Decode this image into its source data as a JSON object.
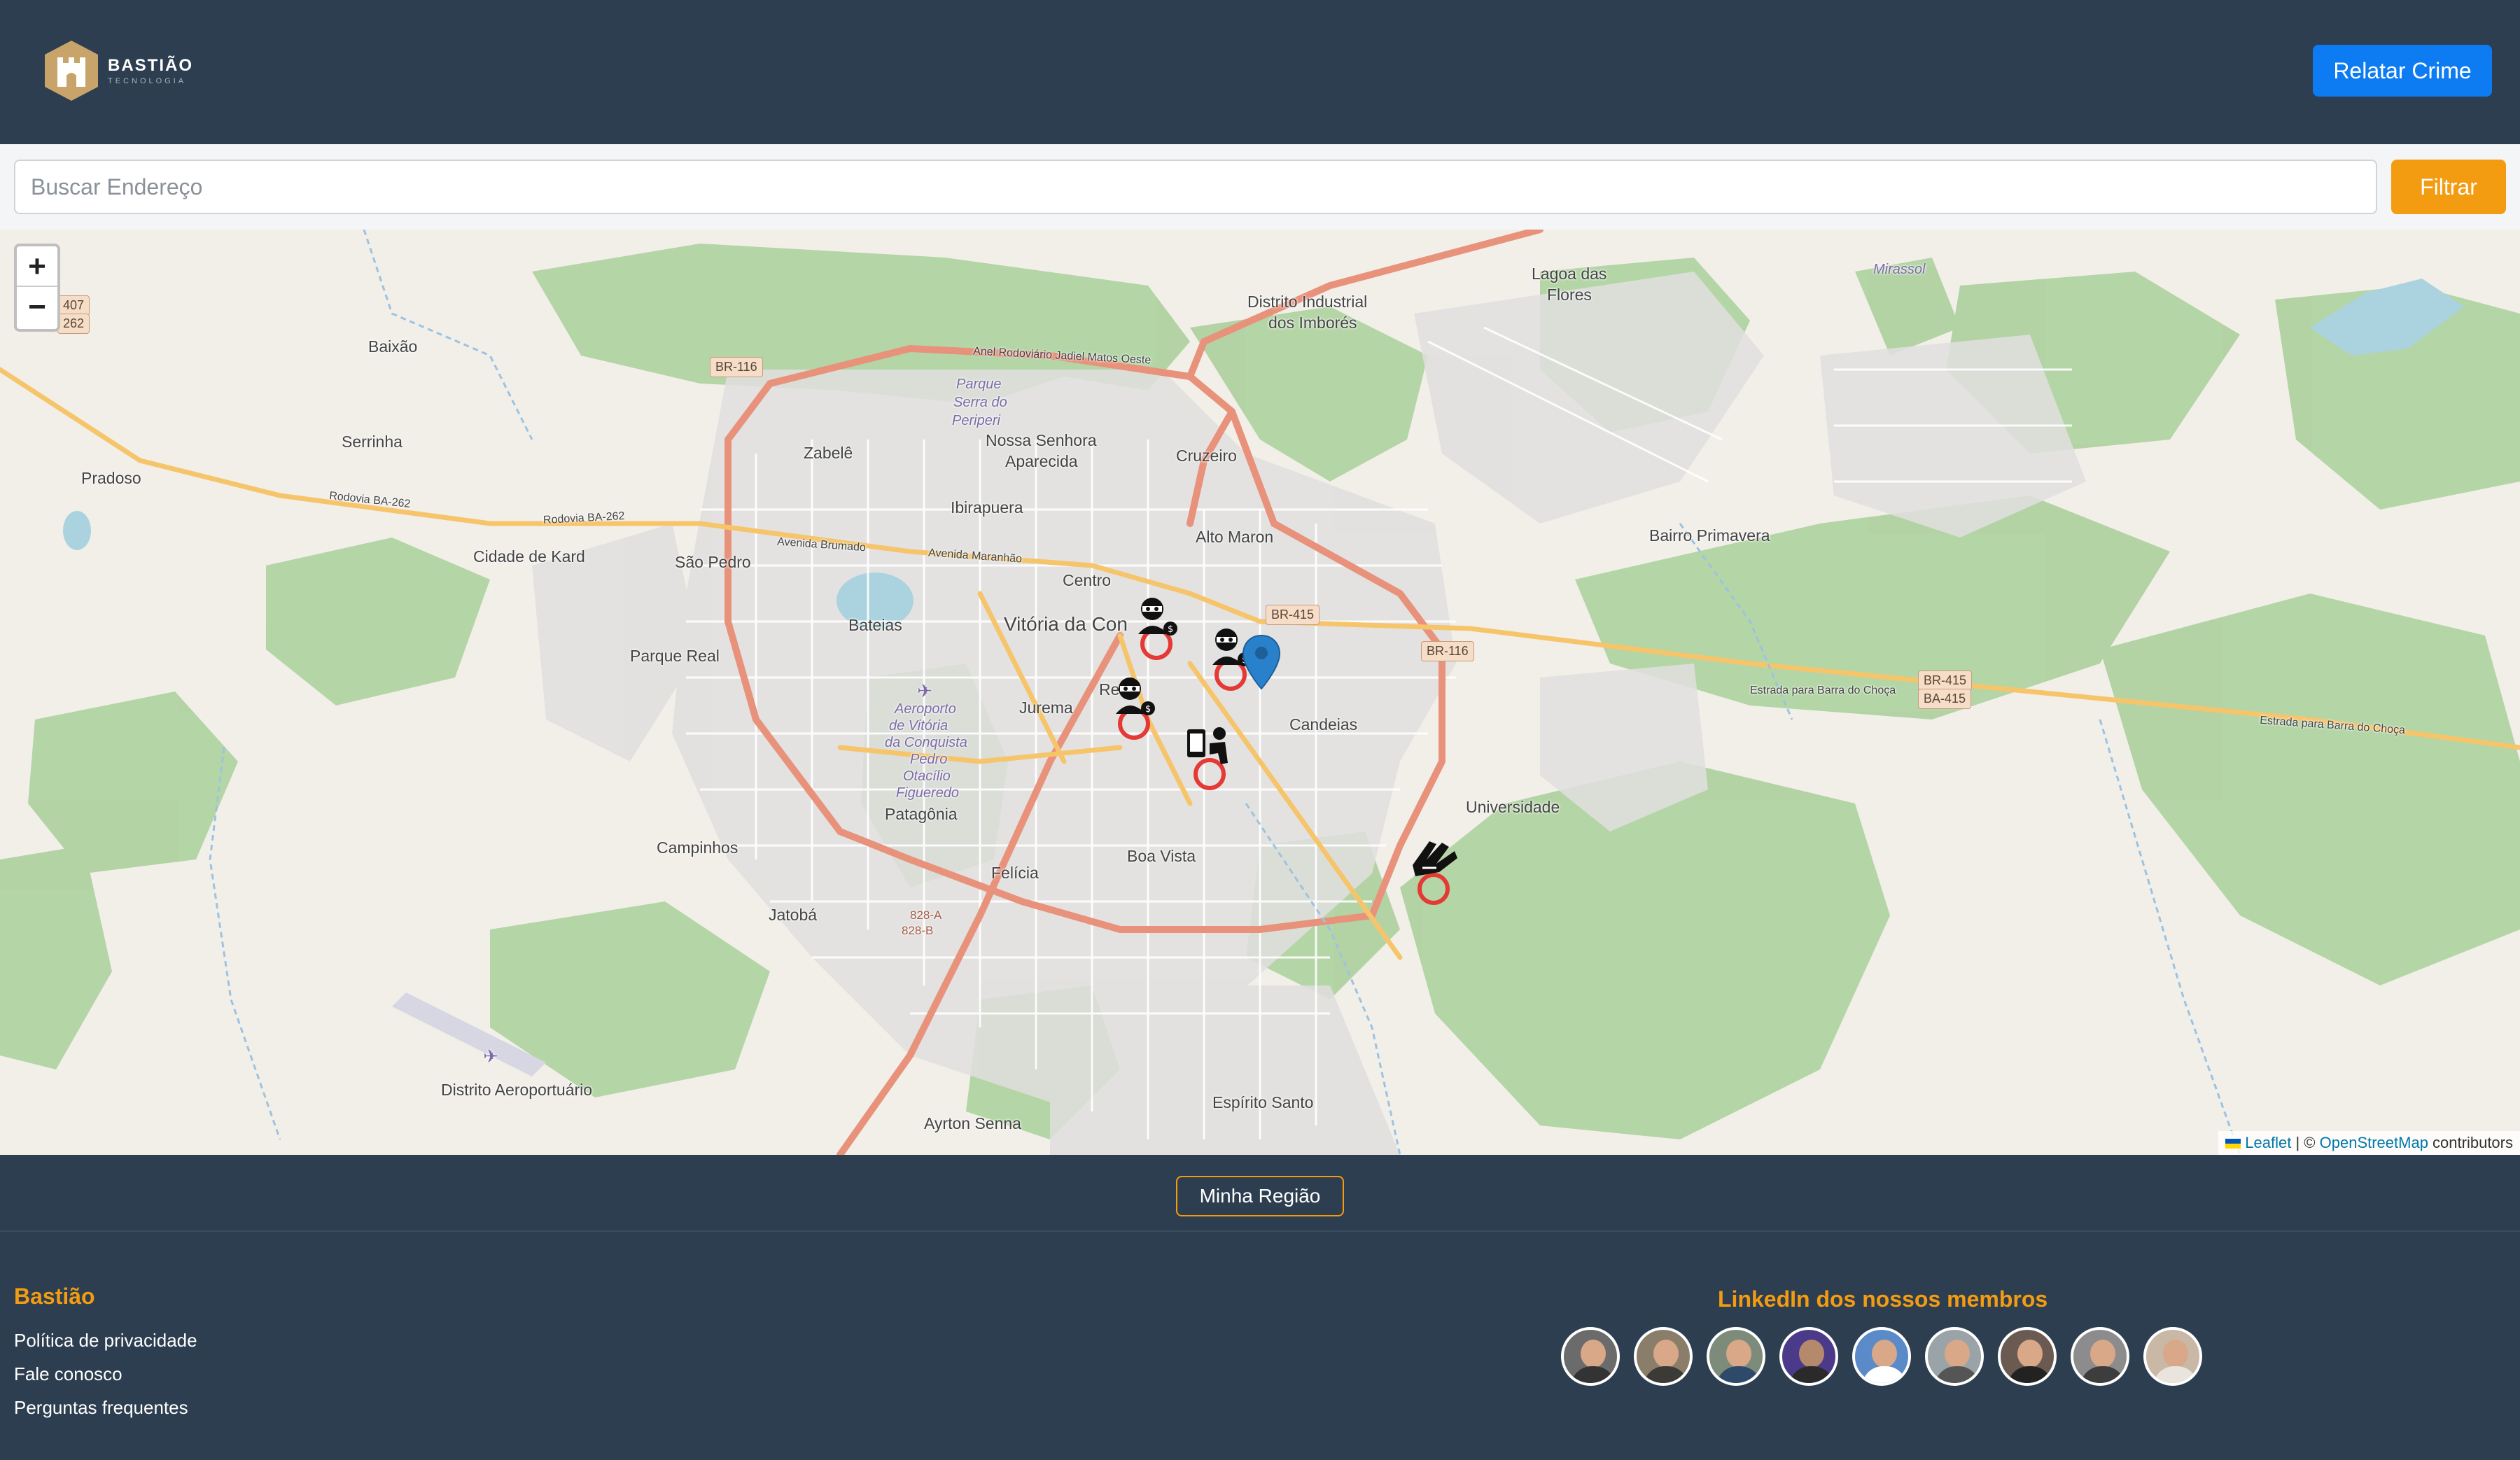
{
  "header": {
    "logo_name": "BASTIÃO",
    "logo_sub": "TECNOLOGIA",
    "report_button": "Relatar Crime"
  },
  "search": {
    "placeholder": "Buscar Endereço",
    "value": "",
    "filter_button": "Filtrar"
  },
  "map": {
    "zoom_in": "+",
    "zoom_out": "−",
    "places": {
      "distrito_industrial": "Distrito Industrial",
      "dos_imbores": "dos Imborés",
      "lagoa_das": "Lagoa das",
      "flores": "Flores",
      "mirassol": "Mirassol",
      "baixao": "Baixão",
      "serrinha": "Serrinha",
      "pradoso": "Pradoso",
      "zabele": "Zabelê",
      "parque_serra": "Parque",
      "serra_do": "Serra do",
      "periperi": "Periperi",
      "nossa_senhora": "Nossa Senhora",
      "aparecida": "Aparecida",
      "cruzeiro": "Cruzeiro",
      "ibirapuera": "Ibirapuera",
      "alto_maron": "Alto Maron",
      "bairro_primavera": "Bairro Primavera",
      "cidade_de_kard": "Cidade de Kard",
      "sao_pedro": "São Pedro",
      "centro": "Centro",
      "bateias": "Bateias",
      "vitoria": "Vitória da Con",
      "parque_real": "Parque Real",
      "recreio": "Re   io",
      "jurema": "Jurema",
      "candeias": "Candeias",
      "aeroporto_1": "Aeroporto",
      "aeroporto_2": "de Vitória",
      "aeroporto_3": "da Conquista",
      "aeroporto_4": "Pedro",
      "aeroporto_5": "Otacílio",
      "aeroporto_6": "Figueredo",
      "patagonia": "Patagônia",
      "universidade": "Universidade",
      "campinhos": "Campinhos",
      "felicia": "Felícia",
      "boa_vista": "Boa Vista",
      "jatoba": "Jatobá",
      "distrito_aeroportuario": "Distrito Aeroportuário",
      "espirito_santo": "Espírito Santo",
      "ayrton_senna": "Ayrton Senna"
    },
    "shields": {
      "ba407": "407",
      "ba262": "262",
      "br116_a": "BR-116",
      "br415_a": "BR-415",
      "br116_b": "BR-116",
      "br415_b": "BR-415",
      "ba415": "BA-415",
      "a828": "828-A",
      "b828": "828-B"
    },
    "street_labels": {
      "anel_oeste": "Anel Rodoviário Jadiel Matos Oeste",
      "rodovia_ba262_a": "Rodovia BA-262",
      "rodovia_ba262_b": "Rodovia BA-262",
      "avenida_brumado": "Avenida Brumado",
      "avenida_maranhao": "Avenida Maranhão",
      "estrada_choca_a": "Estrada para Barra do Choça",
      "estrada_choca_b": "Estrada para Barra do Choça"
    },
    "attribution": {
      "leaflet": "Leaflet",
      "separator": " | © ",
      "osm": "OpenStreetMap",
      "contributors": " contributors"
    },
    "crime_icons": [
      "thief-money-icon",
      "thief-money-icon",
      "thief-money-icon",
      "phone-robbery-icon",
      "hand-grab-icon"
    ],
    "marker_color": "#e53935",
    "pin_color": "#2a81cb"
  },
  "footer": {
    "region_button": "Minha Região",
    "brand_title": "Bastião",
    "links": [
      "Política de privacidade",
      "Fale conosco",
      "Perguntas frequentes"
    ],
    "members_title": "LinkedIn dos nossos membros",
    "member_count": 9
  },
  "colors": {
    "header_bg": "#2c3e50",
    "primary": "#0d7bf2",
    "accent": "#f39c12"
  }
}
